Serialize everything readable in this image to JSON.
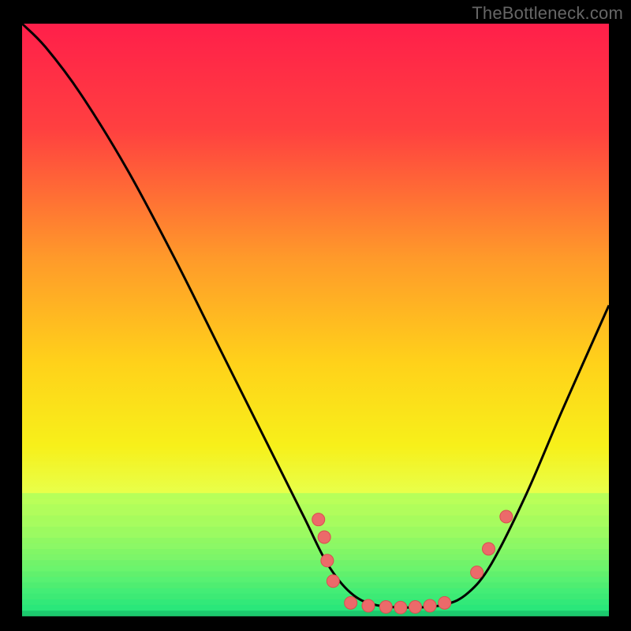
{
  "attribution": "TheBottleneck.com",
  "colors": {
    "bg": "#000000",
    "curve": "#000000",
    "marker_fill": "#ec6a6a",
    "marker_stroke": "#d94f4f",
    "gradient_stops": [
      {
        "offset": "0%",
        "color": "#ff1f4a"
      },
      {
        "offset": "18%",
        "color": "#ff4040"
      },
      {
        "offset": "40%",
        "color": "#ff9a2a"
      },
      {
        "offset": "58%",
        "color": "#ffd21a"
      },
      {
        "offset": "72%",
        "color": "#f7f01a"
      },
      {
        "offset": "80%",
        "color": "#e8ff4a"
      },
      {
        "offset": "86%",
        "color": "#c8ff6a"
      },
      {
        "offset": "92%",
        "color": "#8cff7a"
      },
      {
        "offset": "97%",
        "color": "#30f28a"
      },
      {
        "offset": "100%",
        "color": "#18e67a"
      }
    ],
    "bottom_band_top": "#b6ff5a",
    "bottom_band_bottom": "#20e57c"
  },
  "chart_data": {
    "type": "line",
    "title": "",
    "xlabel": "",
    "ylabel": "",
    "xlim": [
      0,
      100
    ],
    "ylim": [
      0,
      100
    ],
    "curve": [
      {
        "x": 0,
        "y": 100
      },
      {
        "x": 4,
        "y": 96
      },
      {
        "x": 10,
        "y": 88
      },
      {
        "x": 18,
        "y": 75
      },
      {
        "x": 26,
        "y": 60
      },
      {
        "x": 34,
        "y": 44
      },
      {
        "x": 42,
        "y": 28
      },
      {
        "x": 48,
        "y": 16
      },
      {
        "x": 52,
        "y": 8
      },
      {
        "x": 56,
        "y": 3
      },
      {
        "x": 60,
        "y": 1
      },
      {
        "x": 66,
        "y": 0.5
      },
      {
        "x": 72,
        "y": 1
      },
      {
        "x": 76,
        "y": 3
      },
      {
        "x": 80,
        "y": 8
      },
      {
        "x": 86,
        "y": 20
      },
      {
        "x": 92,
        "y": 34
      },
      {
        "x": 100,
        "y": 52
      }
    ],
    "markers": [
      {
        "x": 50.5,
        "y": 15.5
      },
      {
        "x": 51.5,
        "y": 12.5
      },
      {
        "x": 52.0,
        "y": 8.5
      },
      {
        "x": 53.0,
        "y": 5.0
      },
      {
        "x": 56.0,
        "y": 1.3
      },
      {
        "x": 59.0,
        "y": 0.8
      },
      {
        "x": 62.0,
        "y": 0.6
      },
      {
        "x": 64.5,
        "y": 0.5
      },
      {
        "x": 67.0,
        "y": 0.6
      },
      {
        "x": 69.5,
        "y": 0.8
      },
      {
        "x": 72.0,
        "y": 1.3
      },
      {
        "x": 77.5,
        "y": 6.5
      },
      {
        "x": 79.5,
        "y": 10.5
      },
      {
        "x": 82.5,
        "y": 16.0
      }
    ]
  },
  "geometry": {
    "inner_left": 28,
    "inner_top": 30,
    "inner_width": 744,
    "inner_height": 744,
    "marker_radius": 8
  }
}
